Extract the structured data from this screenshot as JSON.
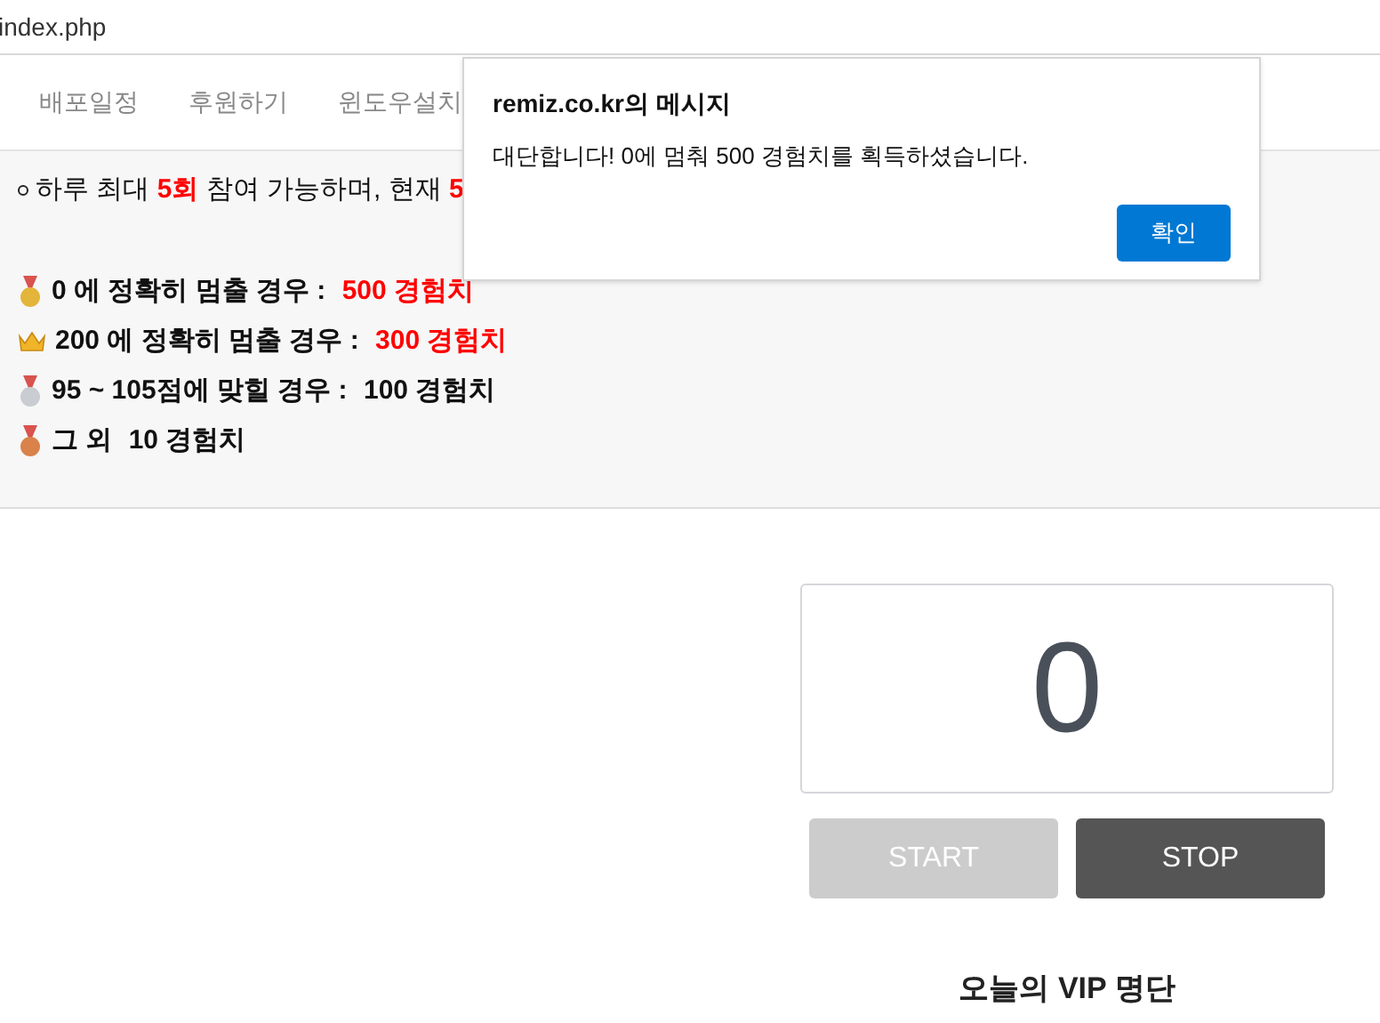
{
  "address_bar": {
    "url": "index.php"
  },
  "nav": {
    "tabs": [
      {
        "label": "배포일정"
      },
      {
        "label": "후원하기"
      },
      {
        "label": "윈도우설치"
      }
    ]
  },
  "notice": {
    "text": "하루 최대 **5회** 참여 가능하며, 현재 **5**"
  },
  "rewards": [
    {
      "kind": "gold",
      "condition": "0 에 정확히 멈출 경우 : ",
      "reward": "500 경험치",
      "highlight": true
    },
    {
      "kind": "crown",
      "condition": "200 에 정확히 멈출 경우 : ",
      "reward": "300 경험치",
      "highlight": true
    },
    {
      "kind": "silver",
      "condition": "95 ~ 105점에 맞힐 경우 : ",
      "reward": "100 경험치",
      "highlight": false
    },
    {
      "kind": "bronze",
      "condition": "그 외 ",
      "reward": "10 경험치",
      "highlight": false
    }
  ],
  "game": {
    "display": "0",
    "buttons": [
      {
        "label": "START",
        "disabled": true
      },
      {
        "label": "STOP",
        "disabled": false
      }
    ]
  },
  "vip": {
    "title": "오늘의 VIP 명단"
  },
  "dialog": {
    "title": "remiz.co.kr의 메시지",
    "message": "대단합니다! 0에 멈춰 500 경험치를 획득하셨습니다.",
    "button": "확인"
  }
}
